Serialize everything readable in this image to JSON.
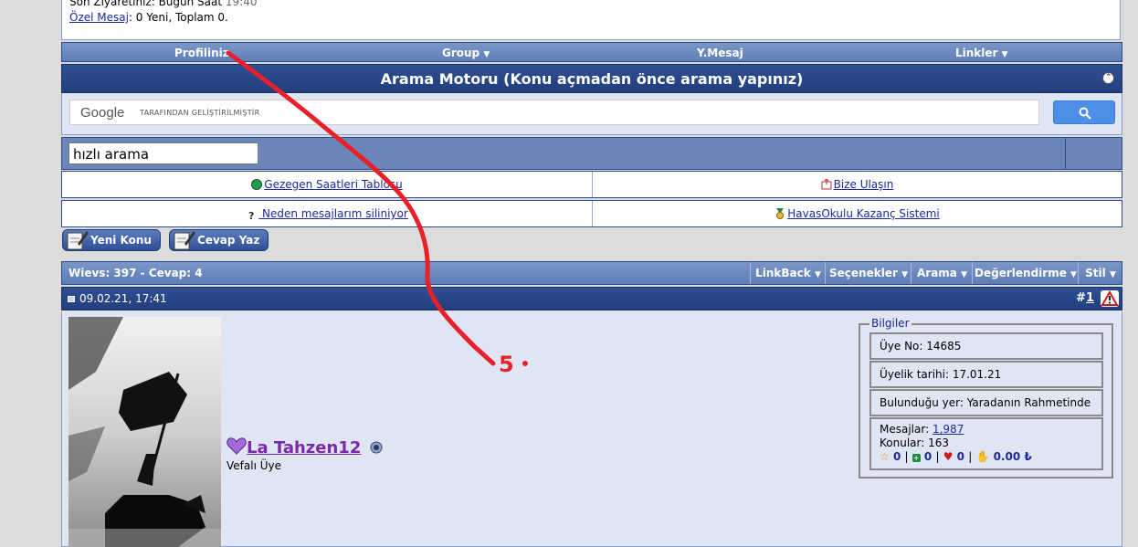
{
  "top_info": {
    "last_visit_label": "Son Ziyaretiniz: Bugün Saat",
    "last_visit_time": "19:40",
    "pm_link": "Özel Mesaj",
    "pm_text": ": 0 Yeni, Toplam 0."
  },
  "navbar": {
    "items": [
      "Profiliniz",
      "Group",
      "Y.Mesaj",
      "Linkler"
    ]
  },
  "search_engine": {
    "title": "Arama Motoru (Konu açmadan önce arama yapınız)",
    "google_logo": "Google",
    "google_tag": "TARAFINDAN GELİŞTİRİLMİŞTİR",
    "quick_search_value": "hızlı arama"
  },
  "links": {
    "row1_left": "Gezegen Saatleri Tablosu",
    "row1_right": "Bize Ulaşın",
    "row2_left": " Neden mesajlarım siliniyor",
    "row2_right": "HavasOkulu Kazanç Sistemi"
  },
  "buttons": {
    "new_topic": "Yeni Konu",
    "reply": "Cevap Yaz"
  },
  "thread_header": {
    "stats": "Wievs: 397 - Cevap: 4",
    "menus": [
      "LinkBack",
      "Seçenekler",
      "Arama",
      "Değerlendirme",
      "Stil"
    ]
  },
  "post": {
    "date": "09.02.21, 17:41",
    "number_prefix": "#",
    "number": "1",
    "username": "La Tahzen12",
    "user_title": "Vefalı Üye",
    "info_legend": "Bilgiler",
    "member_no": "Üye No: 14685",
    "join_date": "Üyelik tarihi: 17.01.21",
    "location": "Bulunduğu yer: Yaradanın Rahmetinde",
    "messages_label": "Mesajlar:",
    "messages_value": "1,987",
    "topics": "Konular: 163",
    "stat_stars": "0",
    "stat_plus": "0",
    "stat_heart": "0",
    "stat_money": "0.00 ₺"
  },
  "annotation": {
    "label": "5",
    "color": "#e8202a"
  }
}
